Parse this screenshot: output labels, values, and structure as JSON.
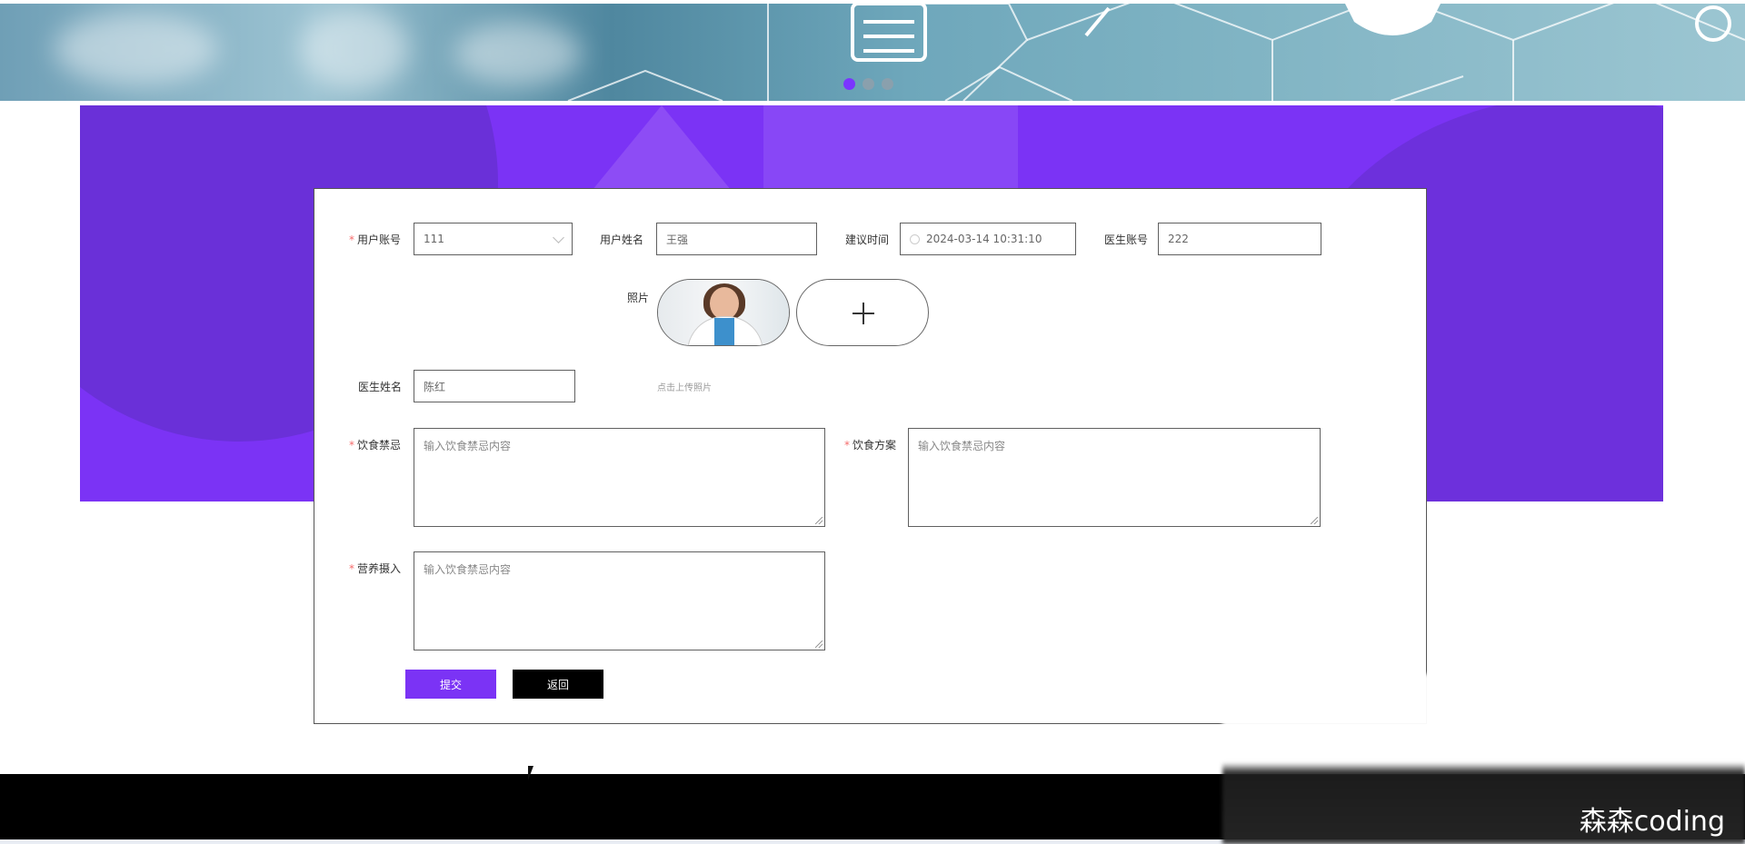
{
  "banner": {
    "carousel_dots": 3,
    "active_index": 0
  },
  "form": {
    "user_account": {
      "label": "用户账号",
      "required": true,
      "value": "111"
    },
    "user_name": {
      "label": "用户姓名",
      "value": "王强"
    },
    "suggest_time": {
      "label": "建议时间",
      "value": "2024-03-14 10:31:10"
    },
    "doctor_account": {
      "label": "医生账号",
      "value": "222"
    },
    "photo": {
      "label": "照片",
      "upload_hint": "点击上传照片"
    },
    "doctor_name": {
      "label": "医生姓名",
      "value": "陈红"
    },
    "diet_taboo": {
      "label": "饮食禁忌",
      "required": true,
      "placeholder": "输入饮食禁忌内容"
    },
    "diet_plan": {
      "label": "饮食方案",
      "required": true,
      "placeholder": "输入饮食禁忌内容"
    },
    "nutrition_intake": {
      "label": "营养摄入",
      "required": true,
      "placeholder": "输入饮食禁忌内容"
    }
  },
  "buttons": {
    "submit": "提交",
    "back": "返回"
  },
  "watermark": "森森coding",
  "colors": {
    "accent": "#7b33f5",
    "footer": "#000000"
  }
}
